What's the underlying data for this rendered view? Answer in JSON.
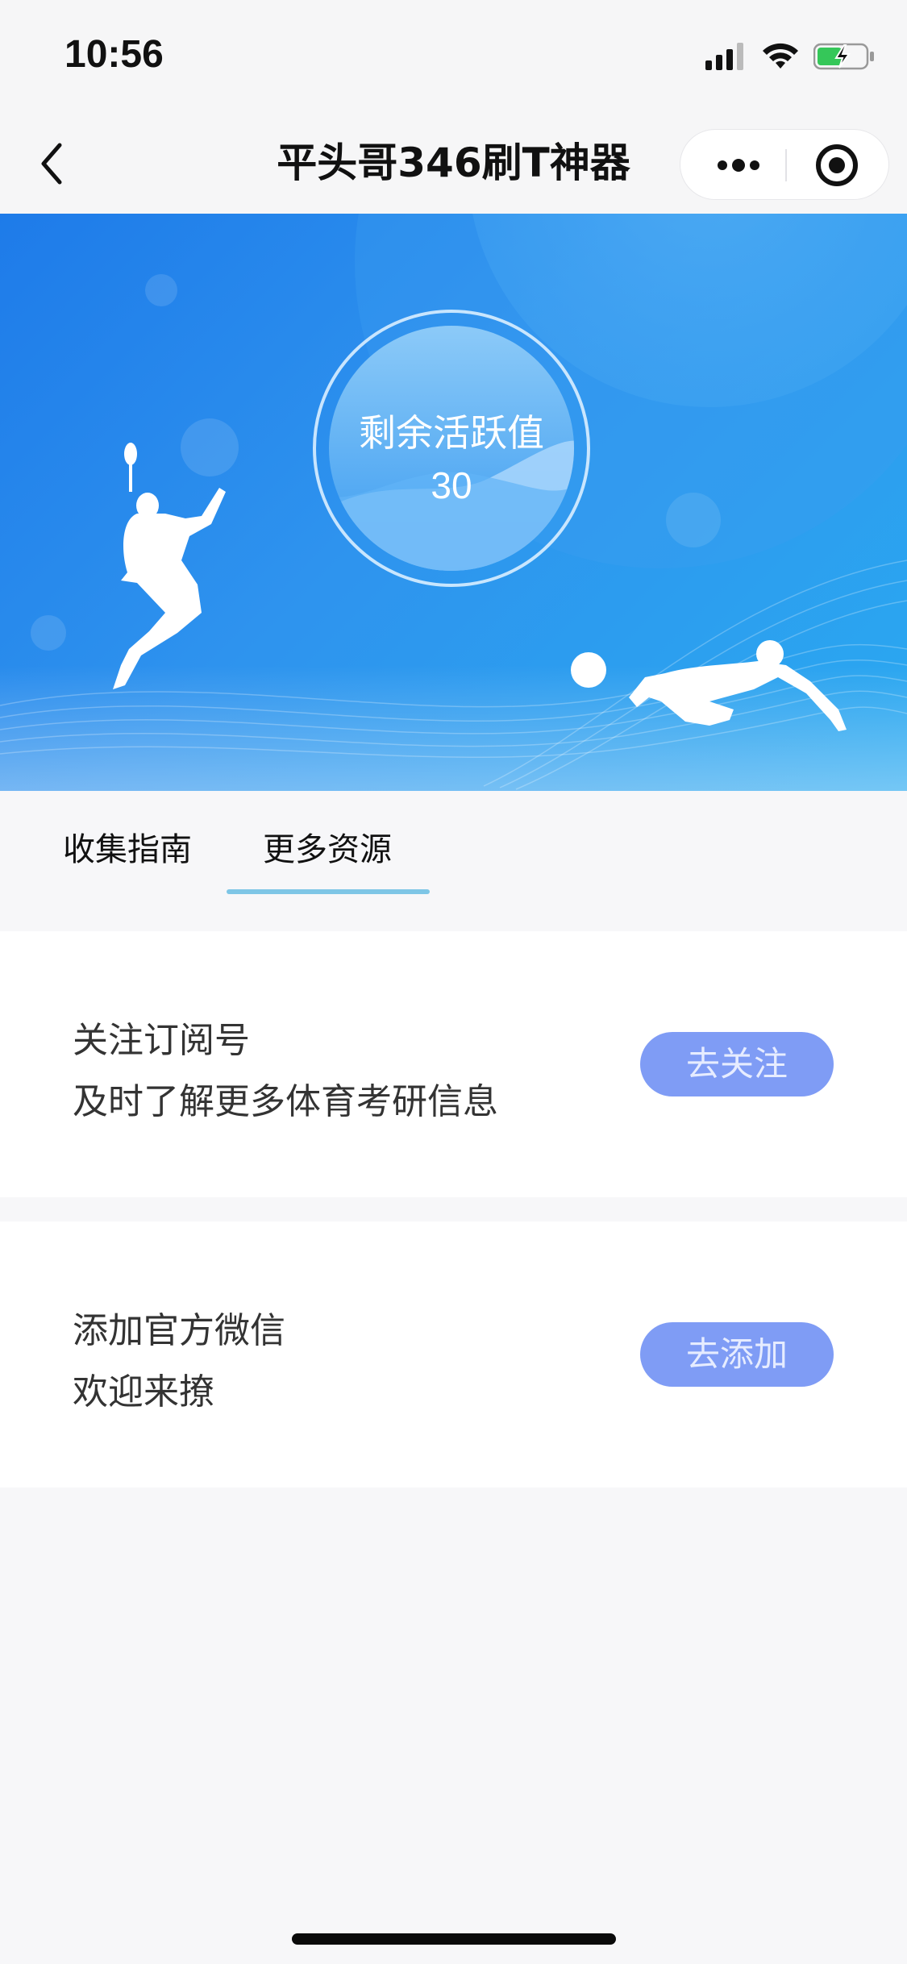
{
  "status_bar": {
    "time": "10:56",
    "icons": [
      "signal-icon",
      "wifi-icon",
      "battery-charging-icon"
    ]
  },
  "nav": {
    "title": "平头哥346刷T神器",
    "icons": [
      "back-icon",
      "more-icon",
      "target-icon"
    ]
  },
  "banner": {
    "label": "剩余活跃值",
    "value": "30",
    "illustrations": [
      "badminton-player-silhouette",
      "volleyball-player-silhouette",
      "ball-icon"
    ]
  },
  "tabs": [
    {
      "label": "收集指南",
      "active": false
    },
    {
      "label": "更多资源",
      "active": true
    }
  ],
  "cards": [
    {
      "line1": "关注订阅号",
      "line2": "及时了解更多体育考研信息",
      "button": "去关注"
    },
    {
      "line1": "添加官方微信",
      "line2": "欢迎来撩",
      "button": "去添加"
    }
  ],
  "colors": {
    "banner_start": "#1e7be9",
    "banner_end": "#2aa9f0",
    "tab_underline": "#7ec6e6",
    "button_bg": "#7f9cf5",
    "page_bg": "#f7f7f9"
  }
}
